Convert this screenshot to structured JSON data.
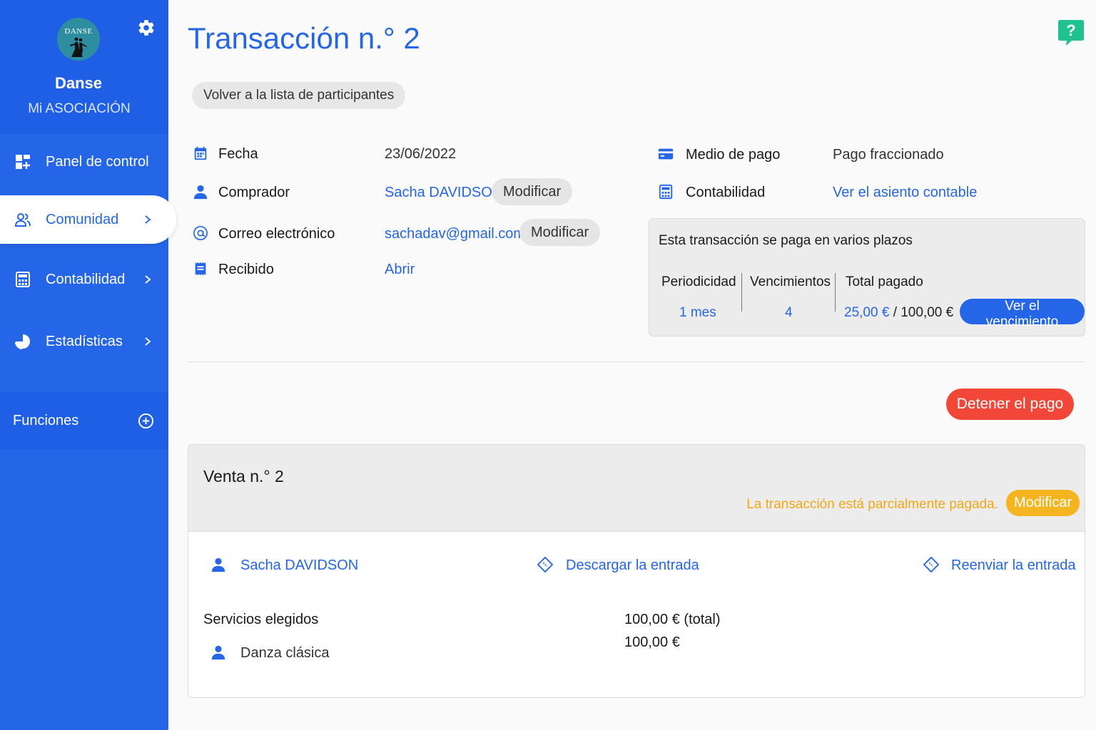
{
  "sidebar": {
    "logo_text": "DANSE",
    "org_name": "Danse",
    "org_subtitle": "Mi ASOCIACIÓN",
    "items": [
      {
        "label": "Panel de control"
      },
      {
        "label": "Comunidad"
      },
      {
        "label": "Contabilidad"
      },
      {
        "label": "Estadísticas"
      }
    ],
    "functions_label": "Funciones"
  },
  "header": {
    "title": "Transacción n.° 2",
    "back_label": "Volver a la lista de participantes",
    "help_label": "?"
  },
  "details": {
    "date_label": "Fecha",
    "date_value": "23/06/2022",
    "buyer_label": "Comprador",
    "buyer_value": "Sacha DAVIDSON",
    "email_label": "Correo electrónico",
    "email_value": "sachadav@gmail.com",
    "receipt_label": "Recibido",
    "receipt_value": "Abrir",
    "modify_label": "Modificar",
    "payment_label": "Medio de pago",
    "payment_value": "Pago fraccionado",
    "accounting_label": "Contabilidad",
    "accounting_value": "Ver el asiento contable"
  },
  "installments": {
    "title": "Esta transacción se paga en varios plazos",
    "periodicity_label": "Periodicidad",
    "periodicity_value": "1 mes",
    "due_count_label": "Vencimientos",
    "due_count_value": "4",
    "total_paid_label": "Total pagado",
    "paid_value": "25,00 €",
    "total_value": "/ 100,00 €",
    "see_due_label": "Ver el vencimiento"
  },
  "stop_payment_label": "Detener el pago",
  "sale": {
    "title": "Venta n.° 2",
    "status": "La transacción está parcialmente pagada.",
    "modify_label": "Modificar",
    "participant": "Sacha DAVIDSON",
    "download_ticket": "Descargar la entrada",
    "resend_ticket": "Reenviar la entrada",
    "services_label": "Servicios elegidos",
    "total_amount": "100,00 € (total)",
    "service_name": "Danza clásica",
    "service_amount": "100,00 €"
  },
  "colors": {
    "primary": "#2566e8",
    "danger": "#f24639",
    "warning": "#f4b521",
    "help": "#1fc28e"
  }
}
